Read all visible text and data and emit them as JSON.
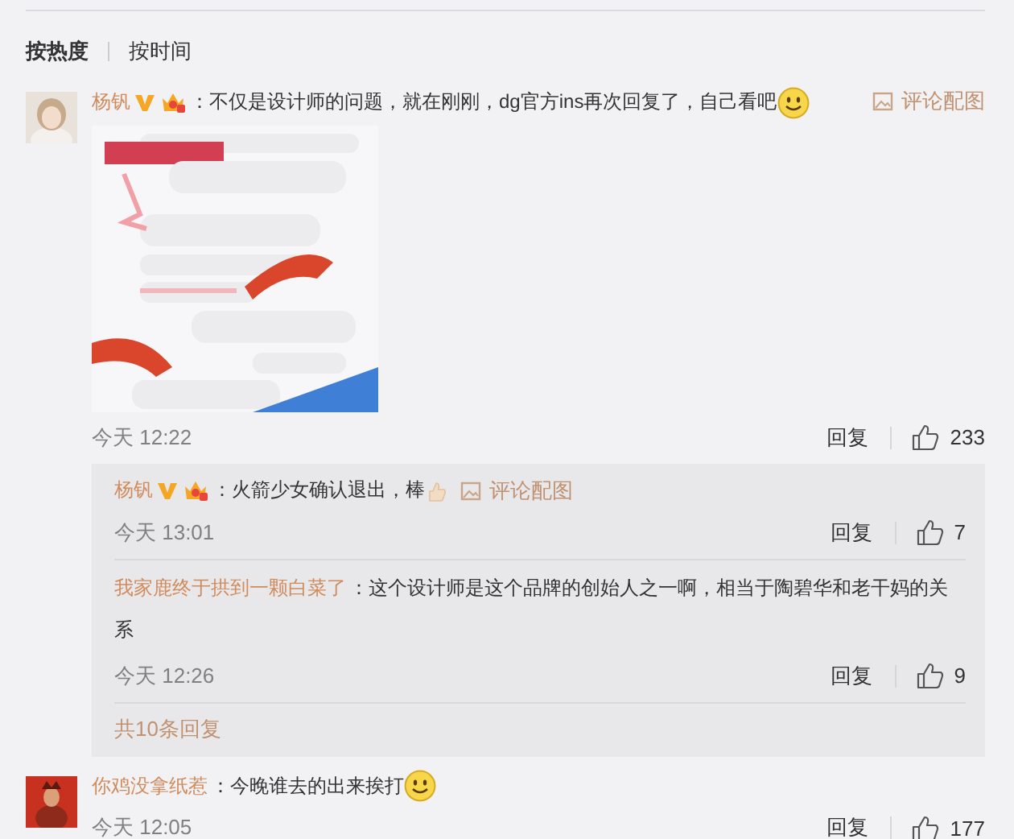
{
  "sort_tabs": [
    {
      "label": "按热度",
      "selected": true
    },
    {
      "label": "按时间",
      "selected": false
    }
  ],
  "comments": [
    {
      "author": "杨钒",
      "verified": true,
      "member_badge": true,
      "text": "：不仅是设计师的问题，就在刚刚，dg官方ins再次回复了，自己看吧",
      "emoji": {
        "kind": "smile"
      },
      "image_link": "评论配图",
      "time": "今天 12:22",
      "reply_label": "回复",
      "likes": "233",
      "replies": [
        {
          "author": "杨钒",
          "verified": true,
          "member_badge": true,
          "text": "：火箭少女确认退出，棒",
          "emoji": {
            "kind": "thumb"
          },
          "image_link": "评论配图",
          "time": "今天 13:01",
          "reply_label": "回复",
          "likes": "7"
        },
        {
          "author": "我家鹿终于拱到一颗白菜了",
          "verified": false,
          "member_badge": false,
          "text": "：这个设计师是这个品牌的创始人之一啊，相当于陶碧华和老干妈的关系",
          "time": "今天 12:26",
          "reply_label": "回复",
          "likes": "9"
        }
      ],
      "more_replies": "共10条回复"
    },
    {
      "author": "你鸡没拿纸惹",
      "verified": false,
      "member_badge": false,
      "text": "：今晚谁去的出来挨打",
      "emoji": {
        "kind": "smile"
      },
      "time": "今天 12:05",
      "reply_label": "回复",
      "likes": "177"
    }
  ]
}
